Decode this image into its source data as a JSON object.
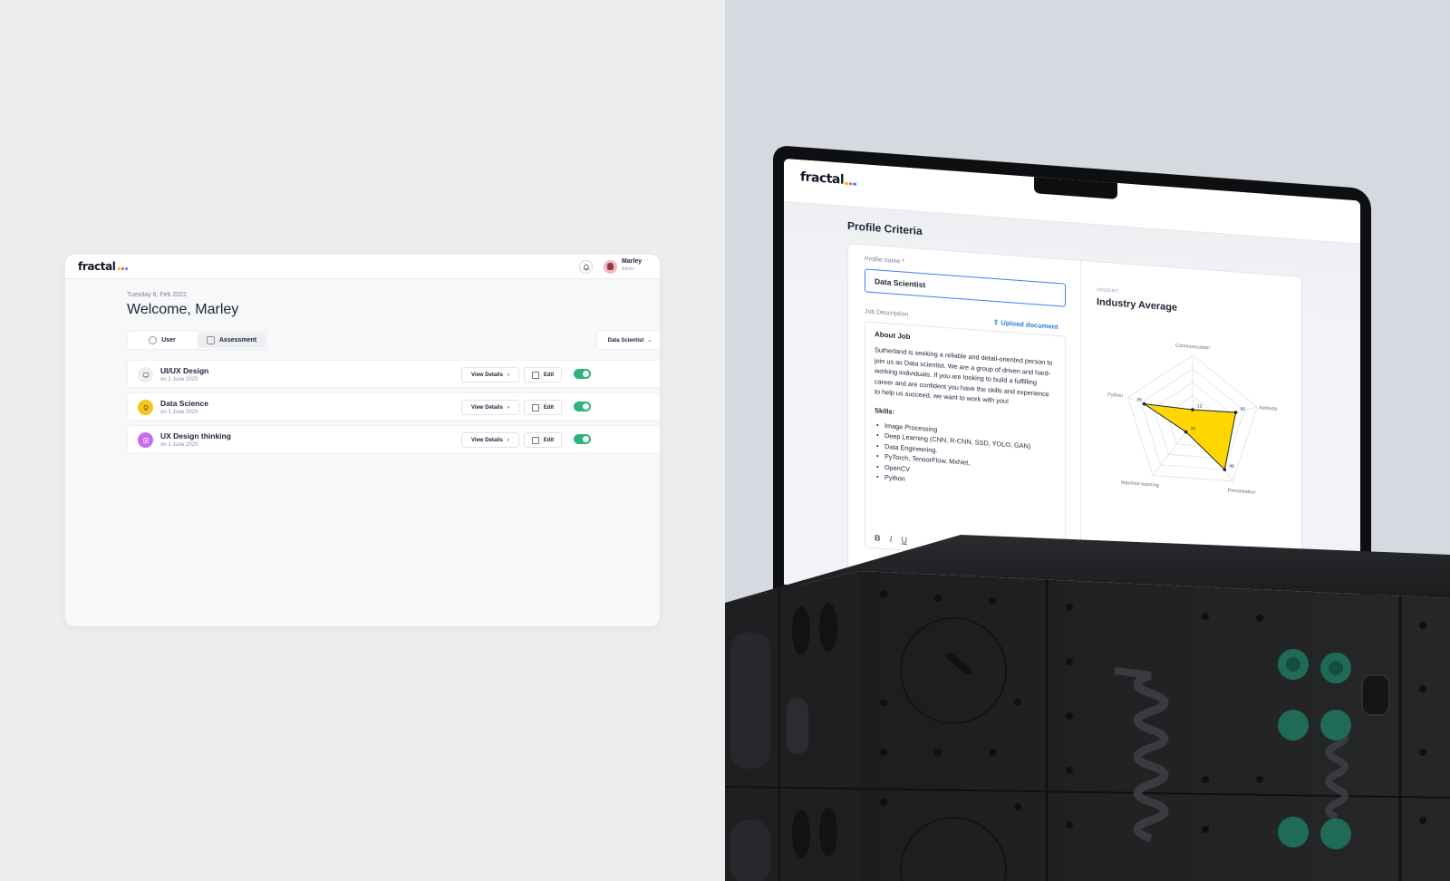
{
  "dashboard": {
    "logo": "fractal",
    "logo_dot_colors": [
      "#f4b400",
      "#e94e3c",
      "#3b82f6"
    ],
    "user": {
      "name": "Marley",
      "role": "Admin"
    },
    "date": "Tuesday 8, Feb 2022",
    "welcome": "Welcome, Marley",
    "tabs": [
      {
        "label": "User",
        "icon": "user-circle-icon"
      },
      {
        "label": "Assessment",
        "icon": "assessment-icon",
        "active": true
      }
    ],
    "role_filter": "Data Scientist",
    "rows": [
      {
        "title": "UI/UX Design",
        "date": "on 2 June 2023",
        "icon": "monitor-icon",
        "icon_bg": "#eceef1",
        "enabled": true
      },
      {
        "title": "Data Science",
        "date": "on 1 June 2023",
        "icon": "bulb-icon",
        "icon_bg": "#f5c518",
        "enabled": true
      },
      {
        "title": "UX Design thinking",
        "date": "on 1 June 2023",
        "icon": "design-icon",
        "icon_bg": "#c86df0",
        "enabled": true
      }
    ],
    "view_details_label": "View Details",
    "edit_label": "Edit",
    "toggle_color": "#2fb37a"
  },
  "laptop": {
    "logo": "fractal",
    "page_title": "Profile Criteria",
    "profile_name_label": "Profile name",
    "required_mark": "*",
    "profile_name_value": "Data Scientist",
    "job_description_label": "Job Description",
    "upload_label": "Upload document",
    "about_heading": "About Job",
    "about_text": "Sutherland is seeking a reliable and detail-oriented person to join us as Data scientist. We are a group of driven and hard-working individuals. If you are looking to build a fulfilling career and are confident you have the skills and experience to help us succeed, we want to work with you!",
    "skills_heading": "Skills:",
    "skills": [
      "Image Processing",
      "Deep Learning (CNN, R-CNN, SSD, YOLO, GAN)",
      "Data Engineering.",
      "PyTorch, TensorFlow, MxNet,",
      "OpenCV",
      "Python"
    ],
    "insight_label": "INSIGHT",
    "industry_title": "Industry Average",
    "radar_color": "#ffd600",
    "radar_labels": [
      "Communication",
      "Aptitude",
      "Presentation",
      "Machine learning",
      "Python"
    ]
  },
  "chart_data": {
    "type": "radar",
    "title": "Industry Average",
    "categories": [
      "Communication",
      "Aptitude",
      "Presentation",
      "Machine learning",
      "Python"
    ],
    "values": [
      12,
      40,
      48,
      10,
      45
    ],
    "max": 60
  }
}
